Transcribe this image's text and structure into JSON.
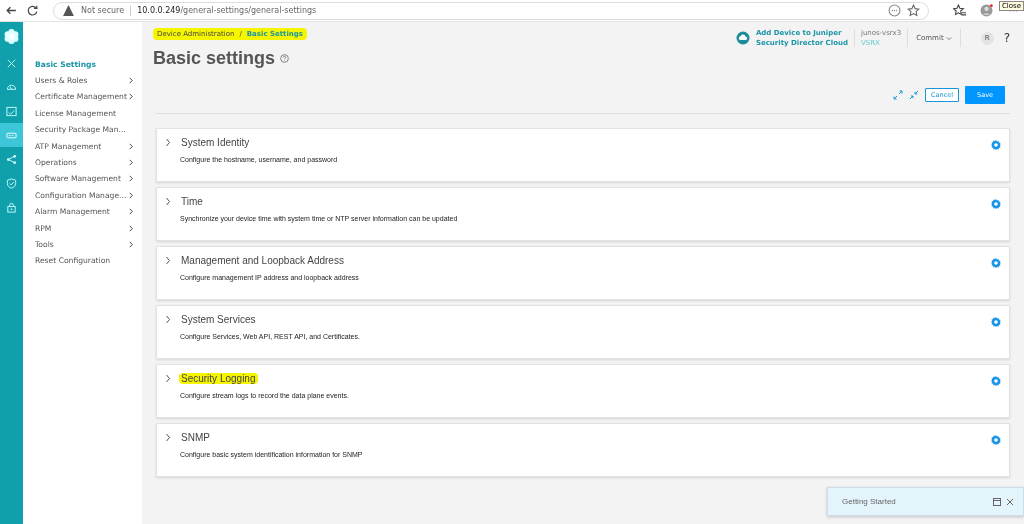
{
  "browser": {
    "security": "Not secure",
    "url_host": "10.0.0.249",
    "url_path": "/general-settings/general-settings",
    "tooltip": "Close"
  },
  "rail": {
    "items": [
      {
        "kind": "close",
        "selected": false
      },
      {
        "kind": "dashboard",
        "selected": false
      },
      {
        "kind": "monitor",
        "selected": false
      },
      {
        "kind": "device",
        "selected": true
      },
      {
        "kind": "network",
        "selected": false
      },
      {
        "kind": "shield",
        "selected": false
      },
      {
        "kind": "lock",
        "selected": false
      }
    ]
  },
  "sidebar": {
    "items": [
      {
        "label": "Basic Settings",
        "selected": true,
        "has_children": false
      },
      {
        "label": "Users & Roles",
        "selected": false,
        "has_children": true
      },
      {
        "label": "Certificate Management",
        "selected": false,
        "has_children": true
      },
      {
        "label": "License Management",
        "selected": false,
        "has_children": false
      },
      {
        "label": "Security Package Man...",
        "selected": false,
        "has_children": false
      },
      {
        "label": "ATP Management",
        "selected": false,
        "has_children": true
      },
      {
        "label": "Operations",
        "selected": false,
        "has_children": true
      },
      {
        "label": "Software Management",
        "selected": false,
        "has_children": true
      },
      {
        "label": "Configuration Manage...",
        "selected": false,
        "has_children": true
      },
      {
        "label": "Alarm Management",
        "selected": false,
        "has_children": true
      },
      {
        "label": "RPM",
        "selected": false,
        "has_children": true
      },
      {
        "label": "Tools",
        "selected": false,
        "has_children": true
      },
      {
        "label": "Reset Configuration",
        "selected": false,
        "has_children": false
      }
    ]
  },
  "breadcrumb": {
    "items": [
      "Device Administration",
      "Basic Settings"
    ],
    "separator": "/",
    "highlighted": true
  },
  "header": {
    "cloud_link": [
      "Add Device to Juniper",
      "Security Director Cloud"
    ],
    "device_name": "junos-vsrx3",
    "device_model": "VSRX",
    "commit": "Commit",
    "avatar": "R",
    "help": "?"
  },
  "page_title": "Basic settings",
  "actions": {
    "cancel": "Cancel",
    "save": "Save"
  },
  "sections": [
    {
      "title": "System Identity",
      "description": "Configure the hostname, username, and password",
      "expanded": false,
      "highlighted": false
    },
    {
      "title": "Time",
      "description": "Synchronize your device time with system time or NTP server information can be updated",
      "expanded": false,
      "highlighted": false
    },
    {
      "title": "Management and Loopback Address",
      "description": "Configure management IP address and loopback address",
      "expanded": false,
      "highlighted": false
    },
    {
      "title": "System Services",
      "description": "Configure Services, Web API, REST API, and Certificates.",
      "expanded": false,
      "highlighted": false
    },
    {
      "title": "Security Logging",
      "description": "Configure stream logs to record the data plane events.",
      "expanded": false,
      "highlighted": true
    },
    {
      "title": "SNMP",
      "description": "Configure basic system identification information for SNMP",
      "expanded": false,
      "highlighted": false
    }
  ],
  "getting_started": {
    "title": "Getting Started"
  }
}
